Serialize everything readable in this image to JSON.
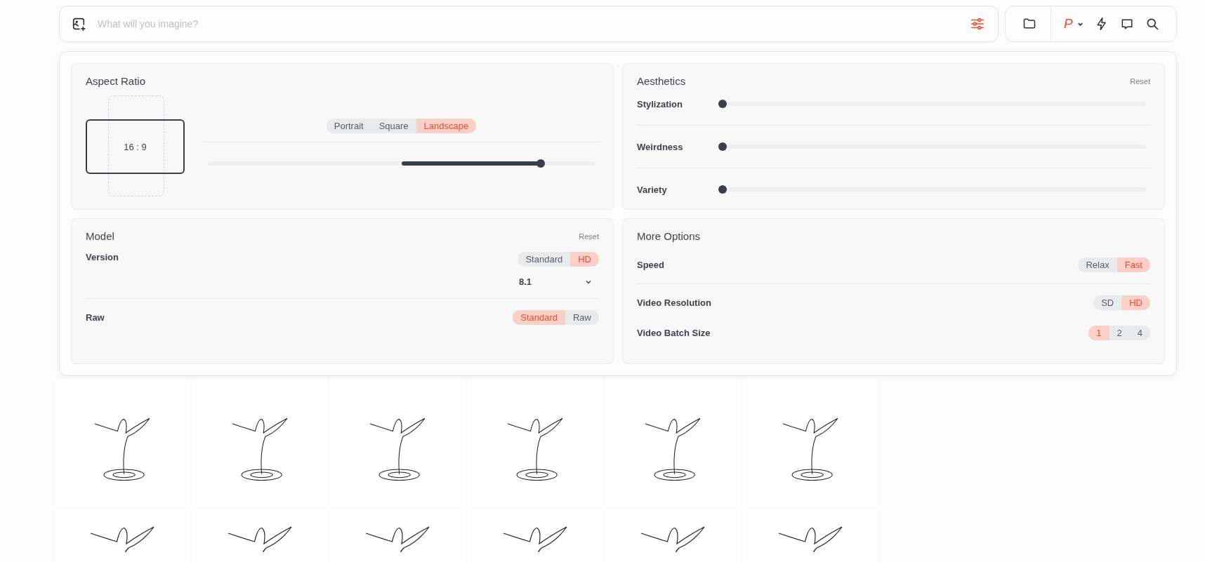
{
  "prompt_bar": {
    "placeholder": "What will you imagine?"
  },
  "toolbar": {
    "profile_letter": "P"
  },
  "aspect_ratio": {
    "title": "Aspect Ratio",
    "ratio": "16 : 9",
    "options": [
      {
        "label": "Portrait",
        "selected": false
      },
      {
        "label": "Square",
        "selected": false
      },
      {
        "label": "Landscape",
        "selected": true
      }
    ],
    "level": 0.86
  },
  "aesthetics": {
    "title": "Aesthetics",
    "reset": "Reset",
    "sliders": [
      {
        "label": "Stylization",
        "level": 0
      },
      {
        "label": "Weirdness",
        "level": 0
      },
      {
        "label": "Variety",
        "level": 0
      }
    ]
  },
  "model": {
    "title": "Model",
    "reset": "Reset",
    "version": {
      "label": "Version",
      "options": [
        {
          "label": "Standard",
          "selected": false
        },
        {
          "label": "HD",
          "selected": true
        }
      ],
      "select_value": "8.1"
    },
    "raw": {
      "label": "Raw",
      "options": [
        {
          "label": "Standard",
          "selected": true
        },
        {
          "label": "Raw",
          "selected": false
        }
      ]
    }
  },
  "more_options": {
    "title": "More Options",
    "rows": [
      {
        "label": "Speed",
        "options": [
          {
            "label": "Relax",
            "selected": false
          },
          {
            "label": "Fast",
            "selected": true
          }
        ]
      },
      {
        "label": "Video Resolution",
        "options": [
          {
            "label": "SD",
            "selected": false
          },
          {
            "label": "HD",
            "selected": true
          }
        ]
      },
      {
        "label": "Video Batch Size",
        "options": [
          {
            "label": "1",
            "selected": true
          },
          {
            "label": "2",
            "selected": false
          },
          {
            "label": "4",
            "selected": false
          }
        ]
      }
    ]
  }
}
